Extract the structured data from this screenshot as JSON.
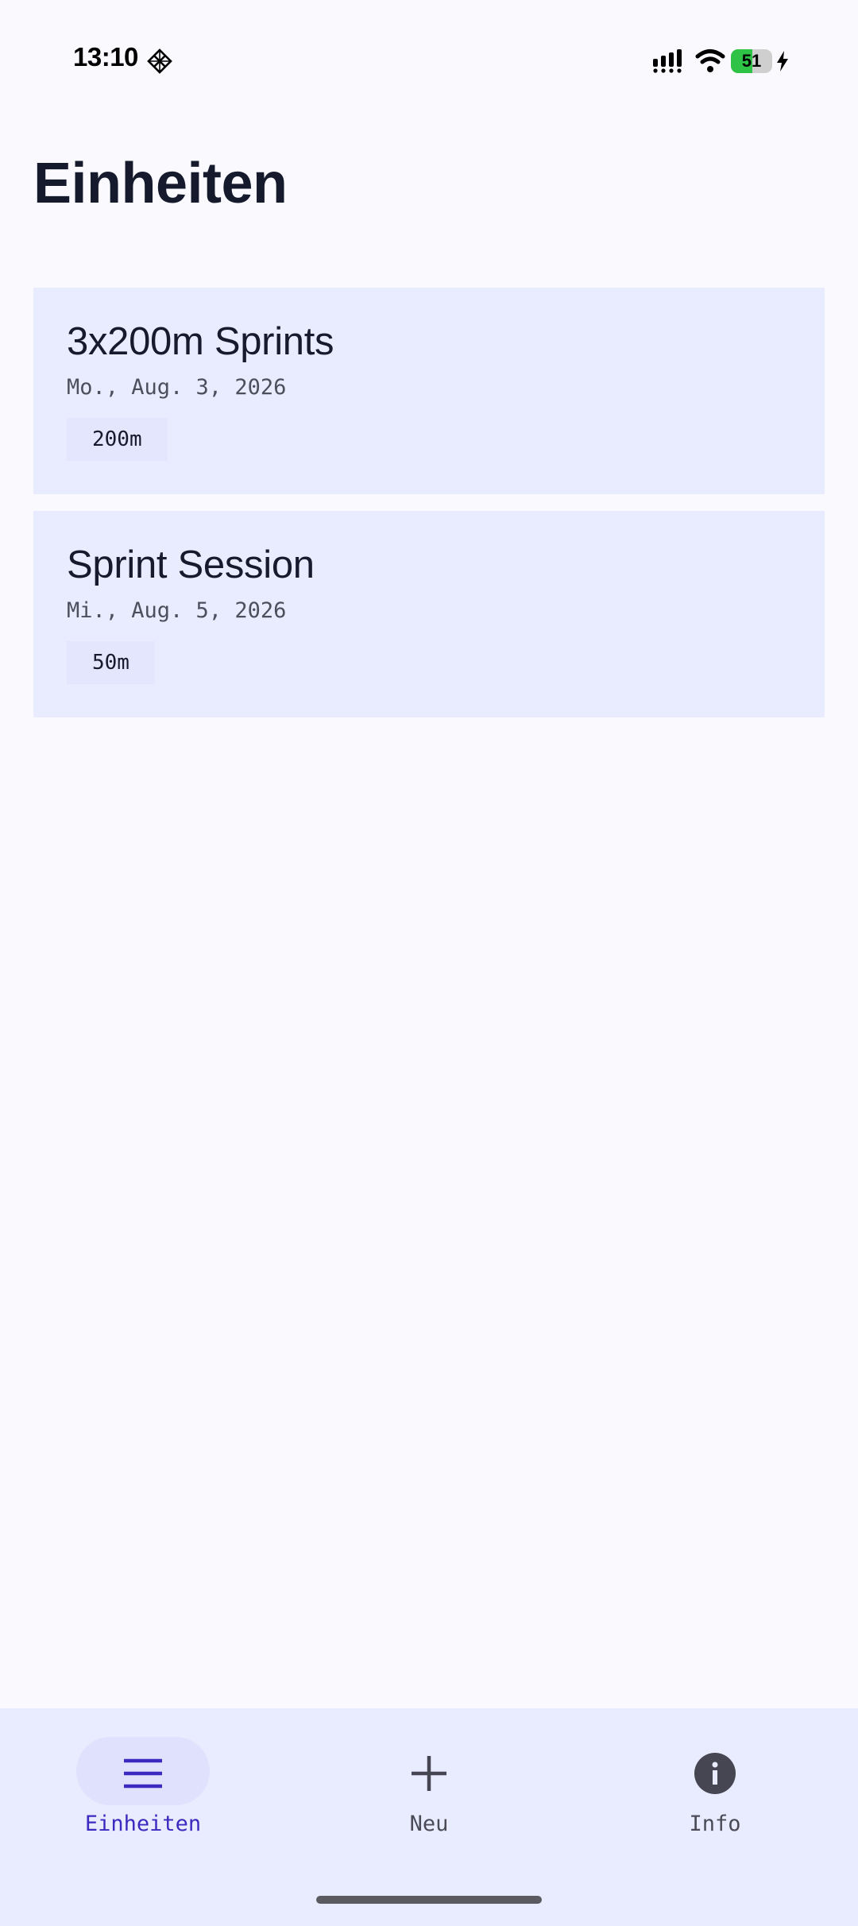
{
  "status_bar": {
    "time": "13:10",
    "battery_level": "51",
    "battery_fraction": 0.51,
    "app_icon": "diamond-grid-icon",
    "signal_icon": "signal-icon",
    "wifi_icon": "wifi-icon",
    "charging_icon": "bolt-icon",
    "battery_color": "#2ec247"
  },
  "header": {
    "title": "Einheiten"
  },
  "sessions": [
    {
      "title": "3x200m Sprints",
      "date": "Mo., Aug. 3, 2026",
      "distance": "200m"
    },
    {
      "title": "Sprint Session",
      "date": "Mi., Aug. 5, 2026",
      "distance": "50m"
    }
  ],
  "bottom_nav": {
    "items": [
      {
        "label": "Einheiten",
        "icon": "menu-icon",
        "active": true
      },
      {
        "label": "Neu",
        "icon": "plus-icon",
        "active": false
      },
      {
        "label": "Info",
        "icon": "info-icon",
        "active": false
      }
    ],
    "accent_color": "#3a2ac0"
  },
  "colors": {
    "background": "#f9f9fe",
    "card": "#e9ecfe",
    "text": "#151a2d"
  }
}
